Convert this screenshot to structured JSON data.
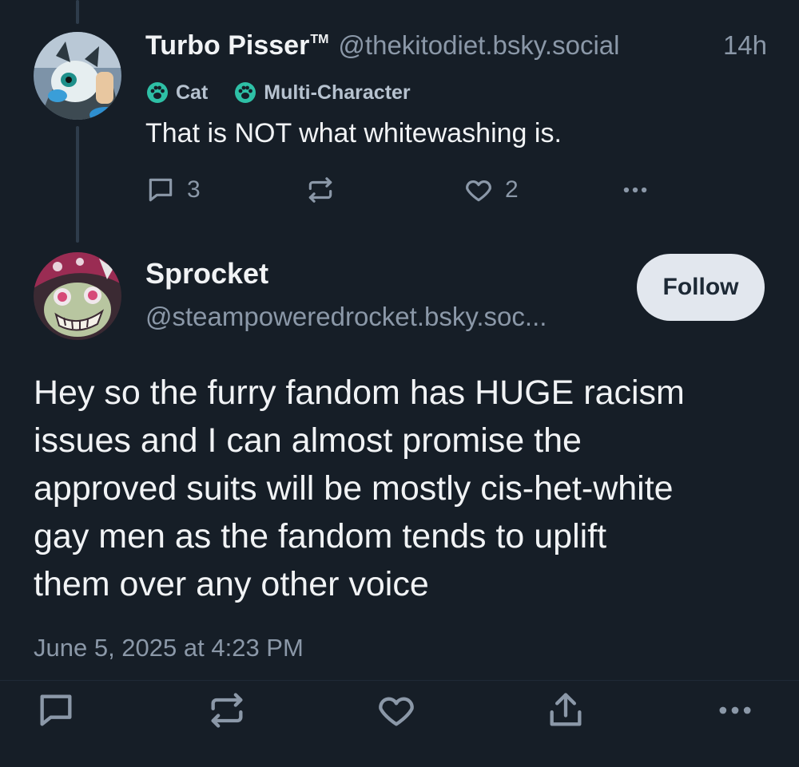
{
  "parent_post": {
    "display_name": "Turbo Pisser",
    "tm": "TM",
    "handle": "@thekitodiet.bsky.social",
    "time": "14h",
    "labels": [
      "Cat",
      "Multi-Character"
    ],
    "text": "That is NOT what whitewashing is.",
    "reply_count": "3",
    "like_count": "2"
  },
  "main_post": {
    "display_name": "Sprocket",
    "handle": "@steampoweredrocket.bsky.soc...",
    "follow_label": "Follow",
    "body_lines": [
      "Hey so the furry fandom has HUGE racism",
      "issues and I can almost promise the",
      "approved suits will be mostly cis-het-white",
      "gay men as the fandom tends to uplift",
      "them over any other voice"
    ],
    "date": "June 5, 2025 at 4:23 PM"
  },
  "colors": {
    "background": "#161e27",
    "text_primary": "#f1f3f5",
    "text_secondary": "#8b98a8",
    "thread_line": "#2e3c4b",
    "follow_bg": "#e2e7ee"
  },
  "icons": {
    "reply": "speech-bubble-icon",
    "repost": "repost-arrows-icon",
    "like": "heart-icon",
    "share": "share-upload-icon",
    "more": "ellipsis-icon",
    "label": "paw-icon"
  }
}
